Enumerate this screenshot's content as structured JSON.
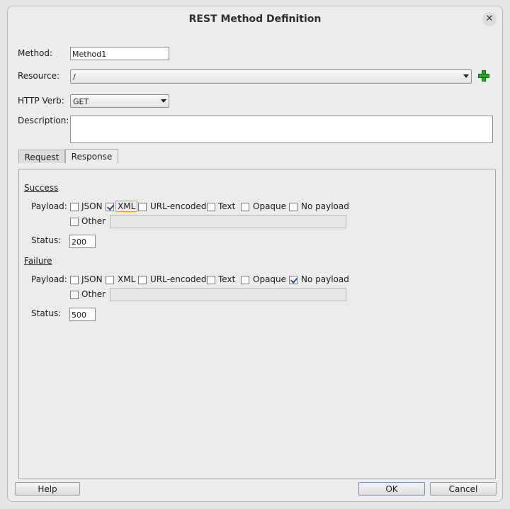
{
  "window": {
    "title": "REST Method Definition"
  },
  "form": {
    "method_label": "Method:",
    "method_value": "Method1",
    "resource_label": "Resource:",
    "resource_value": "/",
    "http_verb_label": "HTTP Verb:",
    "http_verb_value": "GET",
    "description_label": "Description:",
    "description_value": ""
  },
  "tabs": [
    {
      "label": "Request",
      "active": false
    },
    {
      "label": "Response",
      "active": true
    }
  ],
  "response": {
    "success": {
      "heading": "Success",
      "payload_label": "Payload:",
      "options": [
        {
          "label": "JSON",
          "checked": false
        },
        {
          "label": "XML",
          "checked": true
        },
        {
          "label": "URL-encoded",
          "checked": false
        },
        {
          "label": "Text",
          "checked": false
        },
        {
          "label": "Opaque",
          "checked": false
        },
        {
          "label": "No payload",
          "checked": false
        }
      ],
      "other_label": "Other",
      "other_checked": false,
      "other_value": "",
      "status_label": "Status:",
      "status_value": "200"
    },
    "failure": {
      "heading": "Failure",
      "payload_label": "Payload:",
      "options": [
        {
          "label": "JSON",
          "checked": false
        },
        {
          "label": "XML",
          "checked": false
        },
        {
          "label": "URL-encoded",
          "checked": false
        },
        {
          "label": "Text",
          "checked": false
        },
        {
          "label": "Opaque",
          "checked": false
        },
        {
          "label": "No payload",
          "checked": true
        }
      ],
      "other_label": "Other",
      "other_checked": false,
      "other_value": "",
      "status_label": "Status:",
      "status_value": "500"
    }
  },
  "buttons": {
    "help": "Help",
    "ok": "OK",
    "cancel": "Cancel"
  },
  "colors": {
    "add_icon": "#2aa52a",
    "check": "#2b4a8a",
    "focus_outline": "#e89b2c"
  }
}
